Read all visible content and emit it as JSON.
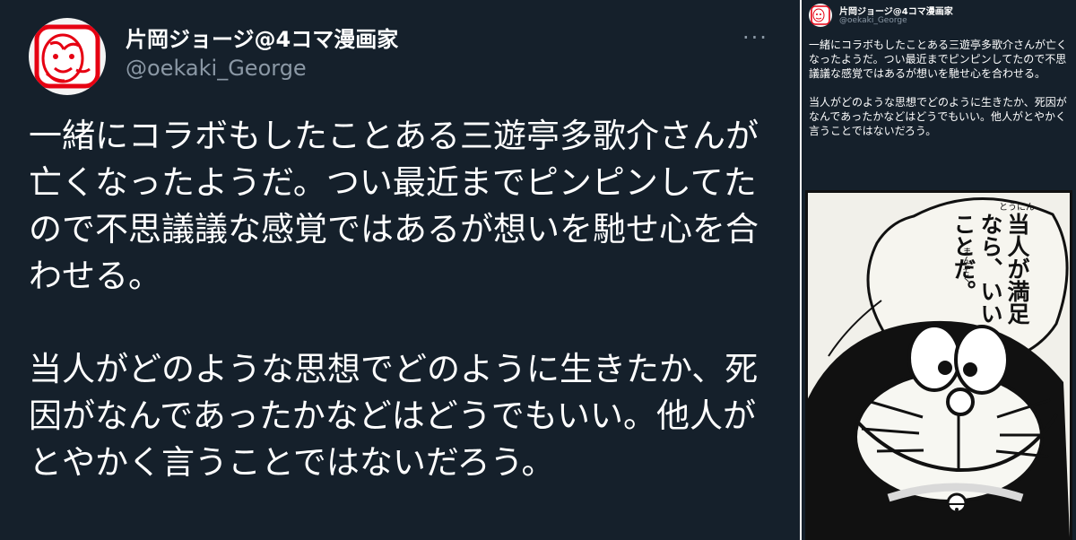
{
  "tweet": {
    "display_name": "片岡ジョージ@4コマ漫画家",
    "handle": "@oekaki_George",
    "more_label": "···",
    "paragraph1": "一緒にコラボもしたことある三遊亭多歌介さんが亡くなったようだ。つい最近までピンピンしてたので不思議議な感覚ではあるが想いを馳せ心を合わせる。",
    "paragraph2": "当人がどのような思想でどのように生きたか、死因がなんであったかなどはどうでもいい。他人がとやかく言うことではないだろう。"
  },
  "preview": {
    "display_name": "片岡ジョージ@4コマ漫画家",
    "handle": "@oekaki_George",
    "paragraph1": "一緒にコラボもしたことある三遊亭多歌介さんが亡くなったようだ。つい最近までピンピンしてたので不思議議な感覚ではあるが想いを馳せ心を合わせる。",
    "paragraph2": "当人がどのような思想でどのように生きたか、死因がなんであったかなどはどうでもいい。他人がとやかく言うことではないだろう。"
  },
  "comic": {
    "speech": "当人が満足なら、いいことだ。",
    "ruby_top": "とうにん",
    "ruby_mid": "まんぞく"
  },
  "colors": {
    "background": "#15202b",
    "secondary_text": "#8b98a5",
    "avatar_red": "#e60012"
  }
}
